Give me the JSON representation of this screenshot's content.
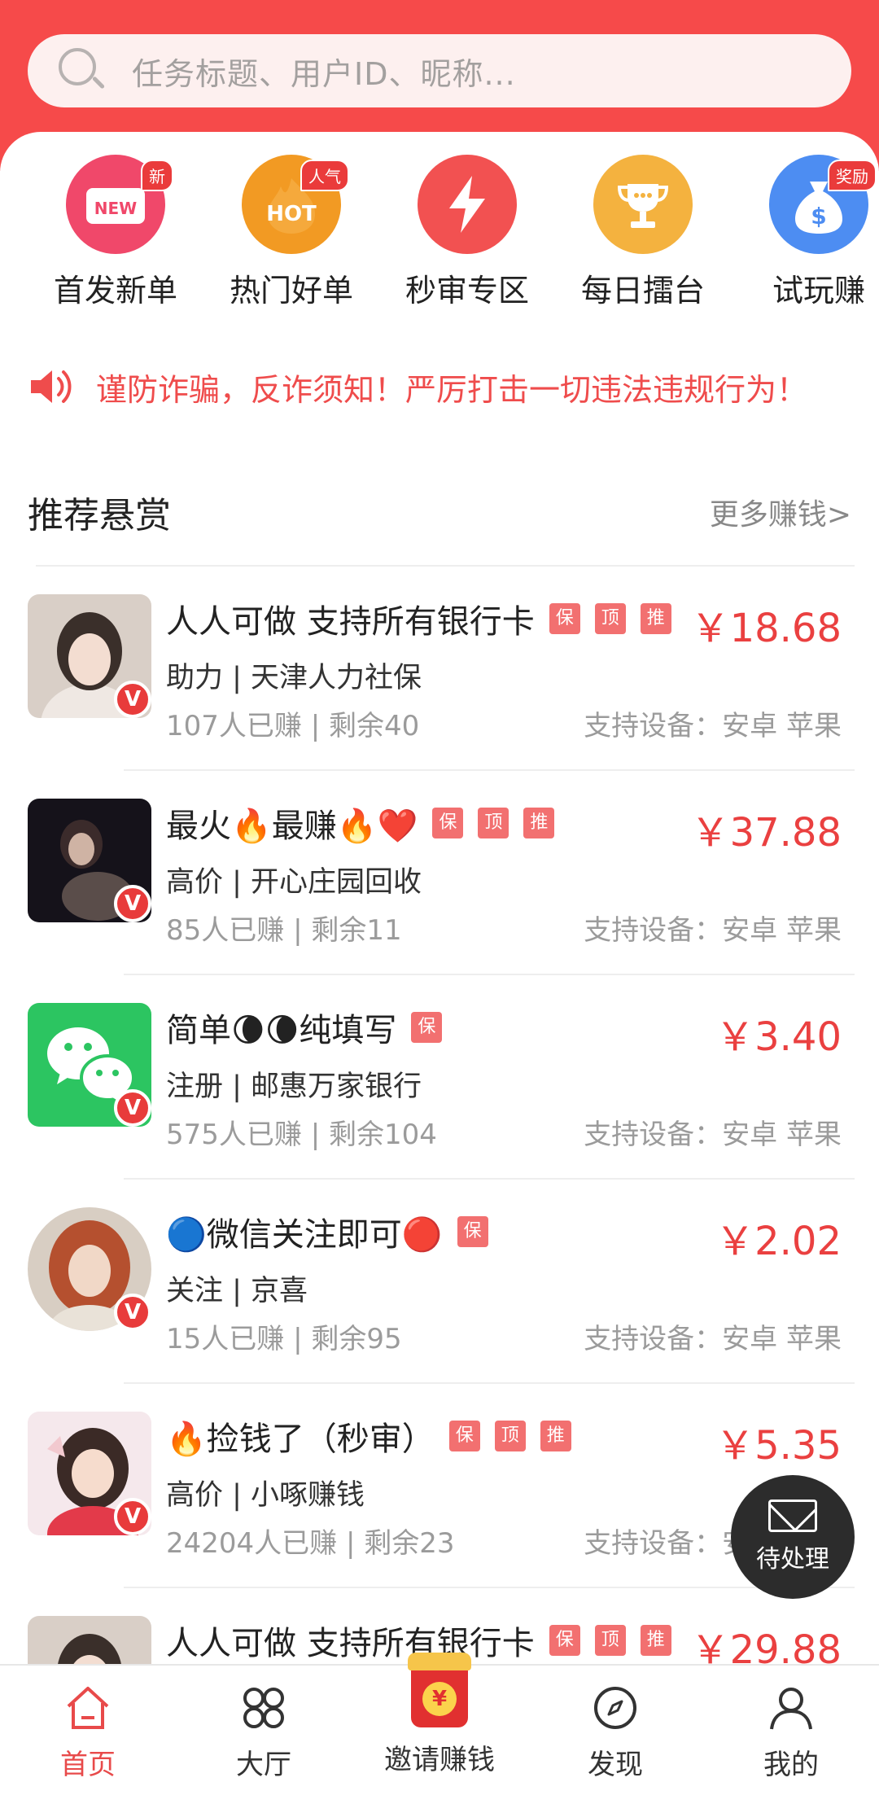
{
  "search": {
    "placeholder": "任务标题、用户ID、昵称..."
  },
  "categories": [
    {
      "label": "首发新单",
      "badge": "新",
      "inner": "NEW",
      "color": "#f0486a",
      "icon": "new-bag-icon"
    },
    {
      "label": "热门好单",
      "badge": "人气",
      "inner": "HOT",
      "color": "#f29a23",
      "icon": "hot-flame-icon"
    },
    {
      "label": "秒审专区",
      "badge": "",
      "inner": "",
      "color": "#f25151",
      "icon": "lightning-icon"
    },
    {
      "label": "每日擂台",
      "badge": "",
      "inner": "",
      "color": "#f4b23f",
      "icon": "trophy-icon"
    },
    {
      "label": "试玩赚",
      "badge": "奖励",
      "inner": "$",
      "color": "#4d8df2",
      "icon": "money-bag-icon"
    }
  ],
  "notice": {
    "text": "谨防诈骗，反诈须知！严厉打击一切违法违规行为！"
  },
  "section": {
    "title": "推荐悬赏",
    "more": "更多赚钱>"
  },
  "items": [
    {
      "title": "人人可做 支持所有银行卡",
      "tags": [
        "保",
        "顶",
        "推"
      ],
      "price": "￥18.68",
      "sub": "助力 | 天津人力社保",
      "stats": "107人已赚 |  剩余40",
      "device": "支持设备：安卓 苹果",
      "avatar": "portrait-1"
    },
    {
      "title": "最火🔥最赚🔥❤️",
      "tags": [
        "保",
        "顶",
        "推"
      ],
      "price": "￥37.88",
      "sub": "高价 | 开心庄园回收",
      "stats": "85人已赚 |  剩余11",
      "device": "支持设备：安卓 苹果",
      "avatar": "portrait-2"
    },
    {
      "title": "简单🌘🌘纯填写",
      "tags": [
        "保"
      ],
      "price": "￥3.40",
      "sub": "注册 | 邮惠万家银行",
      "stats": "575人已赚 |  剩余104",
      "device": "支持设备：安卓 苹果",
      "avatar": "wechat"
    },
    {
      "title": "🔵微信关注即可🔴",
      "tags": [
        "保"
      ],
      "price": "￥2.02",
      "sub": "关注 | 京喜",
      "stats": "15人已赚 |  剩余95",
      "device": "支持设备：安卓 苹果",
      "avatar": "portrait-3"
    },
    {
      "title": "🔥捡钱了（秒审）",
      "tags": [
        "保",
        "顶",
        "推"
      ],
      "price": "￥5.35",
      "sub": "高价 | 小啄赚钱",
      "stats": "24204人已赚 |  剩余23",
      "device": "支持设备：安卓 苹果",
      "avatar": "portrait-4"
    },
    {
      "title": "人人可做 支持所有银行卡",
      "tags": [
        "保",
        "顶",
        "推"
      ],
      "price": "￥29.88",
      "sub": "",
      "stats": "",
      "device": "",
      "avatar": "portrait-1"
    }
  ],
  "float_button": {
    "label": "待处理"
  },
  "tabs": [
    {
      "label": "首页",
      "icon": "home-icon",
      "active": true
    },
    {
      "label": "大厅",
      "icon": "grid-icon",
      "active": false
    },
    {
      "label": "邀请赚钱",
      "icon": "red-envelope-icon",
      "active": false
    },
    {
      "label": "发现",
      "icon": "compass-icon",
      "active": false
    },
    {
      "label": "我的",
      "icon": "user-icon",
      "active": false
    }
  ],
  "colors": {
    "brand": "#f64a4a",
    "price": "#ea4040",
    "tag": "#f27070",
    "notice": "#ef4c4c"
  }
}
